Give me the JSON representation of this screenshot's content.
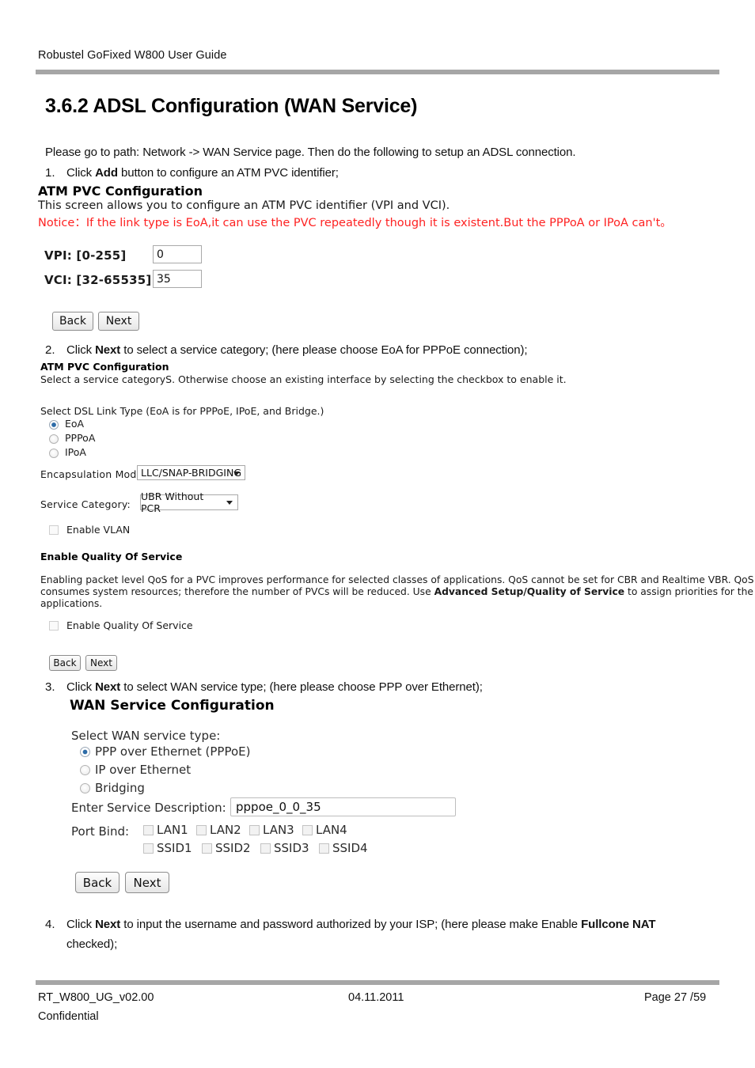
{
  "header": {
    "title": "Robustel GoFixed W800 User Guide"
  },
  "section": {
    "title": "3.6.2 ADSL Configuration (WAN Service)",
    "intro": "Please go to path: Network -> WAN Service page. Then do the following to setup an ADSL connection."
  },
  "steps": [
    {
      "num": "1.",
      "pre": "Click ",
      "bold": "Add",
      "post": " button to configure an ATM PVC identifier;"
    },
    {
      "num": "2.",
      "pre": "Click ",
      "bold": "Next",
      "post": " to select a service category; (here please choose EoA for PPPoE connection);"
    },
    {
      "num": "3.",
      "pre": "Click ",
      "bold": "Next",
      "post": " to select WAN service type; (here please choose PPP over Ethernet);"
    },
    {
      "num": "4.",
      "pre": "Click ",
      "bold": "Next",
      "post": " to input the username and password authorized by your ISP; (here please make Enable ",
      "bold2": "Fullcone NAT",
      "line2": "checked);"
    }
  ],
  "shot1": {
    "heading": "ATM PVC Configuration",
    "desc": "This screen allows you to configure an ATM PVC identifier (VPI and VCI).",
    "notice": "Notice：If the link type is EoA,it can use the PVC repeatedly though it is existent.But the PPPoA or IPoA can't。",
    "vpi_label": "VPI: [0-255]",
    "vpi_value": "0",
    "vci_label": "VCI: [32-65535]",
    "vci_value": "35",
    "back_label": "Back",
    "next_label": "Next"
  },
  "shot2": {
    "heading": "ATM PVC Configuration",
    "desc": "Select a service categoryS. Otherwise choose an existing interface by selecting the checkbox to enable it.",
    "dsl_label": "Select DSL Link Type (EoA is for PPPoE, IPoE, and Bridge.)",
    "dsl_options": [
      {
        "label": "EoA",
        "selected": true
      },
      {
        "label": "PPPoA",
        "selected": false
      },
      {
        "label": "IPoA",
        "selected": false
      }
    ],
    "encap_label": "Encapsulation Mode:",
    "encap_value": "LLC/SNAP-BRIDGING",
    "svccat_label": "Service Category:",
    "svccat_value": "UBR Without PCR",
    "vlan_label": "Enable VLAN",
    "vlan_checked": false,
    "qos_heading": "Enable Quality Of Service",
    "qos_p1": "Enabling packet level QoS for a PVC improves performance for selected classes of applications.  QoS cannot be set for CBR and Realtime VBR.  QoS",
    "qos_p2_a": "consumes system resources; therefore the number of PVCs will be reduced. Use ",
    "qos_p2_b": "Advanced Setup/Quality of Service",
    "qos_p2_c": " to assign priorities for the",
    "qos_p3": "applications.",
    "qos_check_label": "Enable Quality Of Service",
    "qos_checked": false,
    "back_label": "Back",
    "next_label": "Next"
  },
  "shot3": {
    "heading": "WAN Service Configuration",
    "type_label": "Select WAN service type:",
    "type_options": [
      {
        "label": "PPP over Ethernet (PPPoE)",
        "selected": true
      },
      {
        "label": "IP over Ethernet",
        "selected": false
      },
      {
        "label": "Bridging",
        "selected": false
      }
    ],
    "desc_label": "Enter Service Description:",
    "desc_value": "pppoe_0_0_35",
    "portbind_label": "Port Bind:",
    "portbind_row1": [
      "LAN1",
      "LAN2",
      "LAN3",
      "LAN4"
    ],
    "portbind_row2": [
      "SSID1",
      "SSID2",
      "SSID3",
      "SSID4"
    ],
    "back_label": "Back",
    "next_label": "Next"
  },
  "footer": {
    "doc_id": "RT_W800_UG_v02.00",
    "date": "04.11.2011",
    "page": "Page 27 /59",
    "confidential": "Confidential"
  }
}
